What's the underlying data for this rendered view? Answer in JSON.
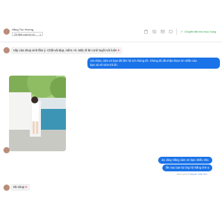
{
  "header": {
    "customer_name": "Hằng Thu Hương",
    "assignee_label": "Chỉ định cuộc trò ch...",
    "done_label": "Chuyển đến thư mục Xong"
  },
  "messages": {
    "in1": "Vậy của shop xinh lắm ý. Chất vải đẹp, mềm. Hi. Mặc đi ăn cưới tuyệt vời luôn",
    "out1_line1": "Xin chào, cảm ơn bạn đã liên hệ với chúng tôi. Chúng tôi đã nhận được tin nhắn của",
    "out1_line2": "bạn và sẽ sớm trả lời.",
    "out2": "dạ vâng Nắng cảm ơn bạn nhiều nha",
    "out3": "lần sau bạn lại ủng hộ Nắng nhé ạ",
    "out_meta_prefix": "Được gửi bởi",
    "out_meta_name": "Nguyễn Xuân Tiến",
    "in2": "Ok shop"
  },
  "colors": {
    "brand_blue": "#1a73e8",
    "done_green": "#1e9e3e",
    "heart_red": "#e23b4a"
  }
}
